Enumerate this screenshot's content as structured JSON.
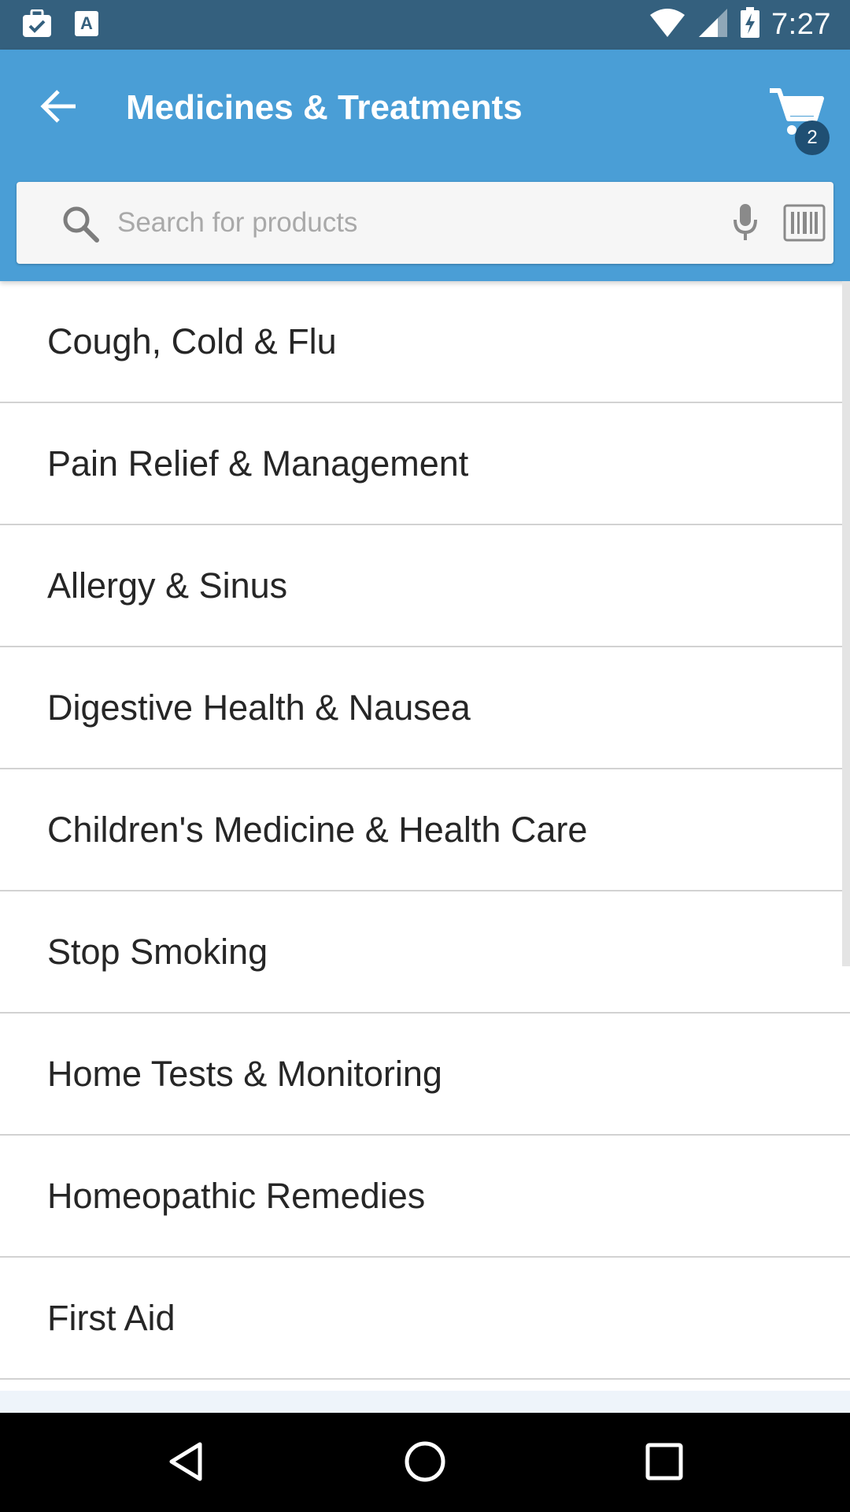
{
  "status_bar": {
    "time": "7:27",
    "left_icons": [
      "briefcase-check-icon",
      "a-text-icon"
    ],
    "right_icons": [
      "wifi-icon",
      "signal-icon",
      "battery-charging-icon"
    ]
  },
  "app_bar": {
    "back_icon": "arrow-back-icon",
    "title": "Medicines & Treatments",
    "cart_icon": "shopping-cart-icon",
    "cart_count": "2",
    "color": "#4a9ed6"
  },
  "search": {
    "placeholder": "Search for products",
    "value": "",
    "icons": [
      "search-icon",
      "microphone-icon",
      "barcode-icon"
    ]
  },
  "categories": [
    {
      "label": "Cough, Cold & Flu"
    },
    {
      "label": "Pain Relief & Management"
    },
    {
      "label": "Allergy & Sinus"
    },
    {
      "label": "Digestive Health & Nausea"
    },
    {
      "label": "Children's Medicine & Health Care"
    },
    {
      "label": "Stop Smoking"
    },
    {
      "label": "Home Tests & Monitoring"
    },
    {
      "label": "Homeopathic Remedies"
    },
    {
      "label": "First Aid"
    }
  ],
  "nav_bar": {
    "icons": [
      "back-triangle-icon",
      "home-circle-icon",
      "recents-square-icon"
    ]
  }
}
